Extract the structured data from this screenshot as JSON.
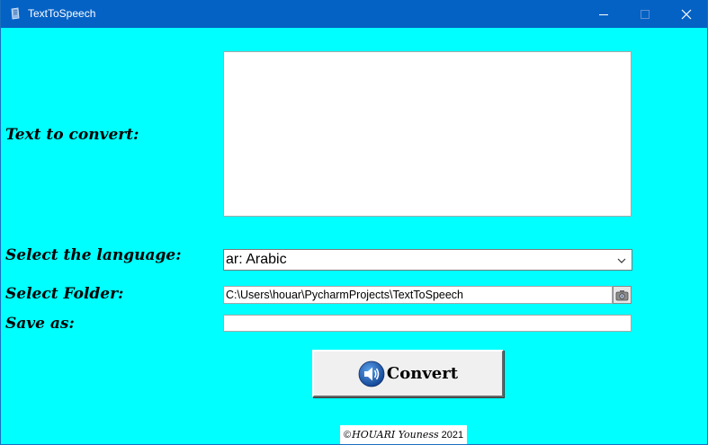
{
  "window": {
    "title": "TextToSpeech",
    "controls": [
      "minimize-icon",
      "maximize-icon",
      "close-icon"
    ]
  },
  "form": {
    "text_label": "Text to convert:",
    "text_value": "",
    "language_label": "Select the language:",
    "language_value": "ar: Arabic",
    "folder_label": "Select Folder:",
    "folder_value": "C:\\Users\\houar\\PycharmProjects\\TextToSpeech",
    "save_label": "Save as:",
    "save_value": ""
  },
  "convert_button": {
    "label": "Convert",
    "icon": "speaker-icon"
  },
  "footer": {
    "copyright_symbol": "©",
    "author": "HOUARI Youness",
    "year": "2021"
  },
  "colors": {
    "background": "#00ffff",
    "titlebar": "#0562c5",
    "speaker_icon": "#1a5fb4"
  }
}
